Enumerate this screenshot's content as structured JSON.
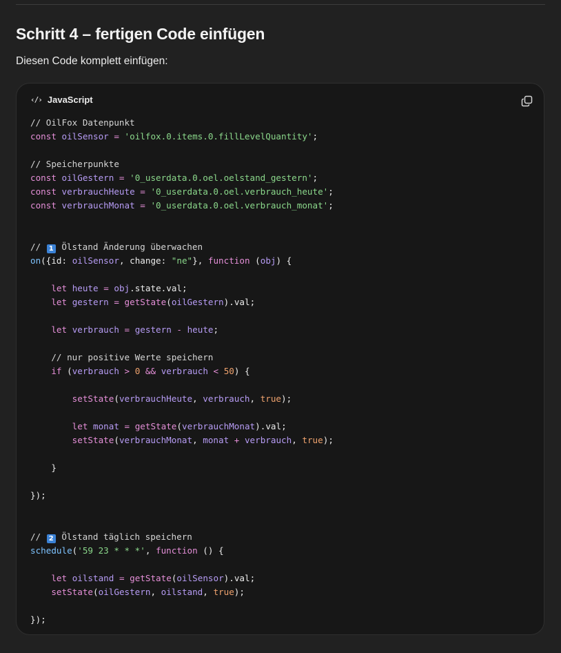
{
  "section": {
    "heading": "Schritt 4 – fertigen Code einfügen",
    "intro": "Diesen Code komplett einfügen:"
  },
  "code_block": {
    "language_label": "JavaScript",
    "language_icon": "code-brackets-icon",
    "copy_icon": "copy-icon",
    "lines": [
      [
        [
          "comment",
          "// OilFox Datenpunkt"
        ]
      ],
      [
        [
          "keyword",
          "const "
        ],
        [
          "var",
          "oilSensor"
        ],
        [
          "plain",
          " "
        ],
        [
          "op",
          "="
        ],
        [
          "plain",
          " "
        ],
        [
          "string",
          "'oilfox.0.items.0.fillLevelQuantity'"
        ],
        [
          "punct",
          ";"
        ]
      ],
      [],
      [
        [
          "comment",
          "// Speicherpunkte"
        ]
      ],
      [
        [
          "keyword",
          "const "
        ],
        [
          "var",
          "oilGestern"
        ],
        [
          "plain",
          " "
        ],
        [
          "op",
          "="
        ],
        [
          "plain",
          " "
        ],
        [
          "string",
          "'0_userdata.0.oel.oelstand_gestern'"
        ],
        [
          "punct",
          ";"
        ]
      ],
      [
        [
          "keyword",
          "const "
        ],
        [
          "var",
          "verbrauchHeute"
        ],
        [
          "plain",
          " "
        ],
        [
          "op",
          "="
        ],
        [
          "plain",
          " "
        ],
        [
          "string",
          "'0_userdata.0.oel.verbrauch_heute'"
        ],
        [
          "punct",
          ";"
        ]
      ],
      [
        [
          "keyword",
          "const "
        ],
        [
          "var",
          "verbrauchMonat"
        ],
        [
          "plain",
          " "
        ],
        [
          "op",
          "="
        ],
        [
          "plain",
          " "
        ],
        [
          "string",
          "'0_userdata.0.oel.verbrauch_monat'"
        ],
        [
          "punct",
          ";"
        ]
      ],
      [],
      [],
      [
        [
          "comment",
          "// "
        ],
        [
          "emoji",
          "1"
        ],
        [
          "comment",
          " Ölstand Änderung überwachen"
        ]
      ],
      [
        [
          "builtin",
          "on"
        ],
        [
          "punct",
          "({"
        ],
        [
          "prop",
          "id: "
        ],
        [
          "var",
          "oilSensor"
        ],
        [
          "punct",
          ", "
        ],
        [
          "prop",
          "change: "
        ],
        [
          "string",
          "\"ne\""
        ],
        [
          "punct",
          "}, "
        ],
        [
          "keyword",
          "function"
        ],
        [
          "plain",
          " "
        ],
        [
          "punct",
          "("
        ],
        [
          "var",
          "obj"
        ],
        [
          "punct",
          ") {"
        ]
      ],
      [],
      [
        [
          "plain",
          "    "
        ],
        [
          "keyword",
          "let "
        ],
        [
          "var",
          "heute"
        ],
        [
          "plain",
          " "
        ],
        [
          "op",
          "="
        ],
        [
          "plain",
          " "
        ],
        [
          "var",
          "obj"
        ],
        [
          "punct",
          "."
        ],
        [
          "prop",
          "state"
        ],
        [
          "punct",
          "."
        ],
        [
          "prop",
          "val"
        ],
        [
          "punct",
          ";"
        ]
      ],
      [
        [
          "plain",
          "    "
        ],
        [
          "keyword",
          "let "
        ],
        [
          "var",
          "gestern"
        ],
        [
          "plain",
          " "
        ],
        [
          "op",
          "="
        ],
        [
          "plain",
          " "
        ],
        [
          "fn",
          "getState"
        ],
        [
          "punct",
          "("
        ],
        [
          "var",
          "oilGestern"
        ],
        [
          "punct",
          ")."
        ],
        [
          "prop",
          "val"
        ],
        [
          "punct",
          ";"
        ]
      ],
      [],
      [
        [
          "plain",
          "    "
        ],
        [
          "keyword",
          "let "
        ],
        [
          "var",
          "verbrauch"
        ],
        [
          "plain",
          " "
        ],
        [
          "op",
          "="
        ],
        [
          "plain",
          " "
        ],
        [
          "var",
          "gestern"
        ],
        [
          "plain",
          " "
        ],
        [
          "op",
          "-"
        ],
        [
          "plain",
          " "
        ],
        [
          "var",
          "heute"
        ],
        [
          "punct",
          ";"
        ]
      ],
      [],
      [
        [
          "plain",
          "    "
        ],
        [
          "comment",
          "// nur positive Werte speichern"
        ]
      ],
      [
        [
          "plain",
          "    "
        ],
        [
          "keyword",
          "if"
        ],
        [
          "plain",
          " "
        ],
        [
          "punct",
          "("
        ],
        [
          "var",
          "verbrauch"
        ],
        [
          "plain",
          " "
        ],
        [
          "op",
          ">"
        ],
        [
          "plain",
          " "
        ],
        [
          "number",
          "0"
        ],
        [
          "plain",
          " "
        ],
        [
          "op",
          "&&"
        ],
        [
          "plain",
          " "
        ],
        [
          "var",
          "verbrauch"
        ],
        [
          "plain",
          " "
        ],
        [
          "op",
          "<"
        ],
        [
          "plain",
          " "
        ],
        [
          "number",
          "50"
        ],
        [
          "punct",
          ") {"
        ]
      ],
      [],
      [
        [
          "plain",
          "        "
        ],
        [
          "fn",
          "setState"
        ],
        [
          "punct",
          "("
        ],
        [
          "var",
          "verbrauchHeute"
        ],
        [
          "punct",
          ", "
        ],
        [
          "var",
          "verbrauch"
        ],
        [
          "punct",
          ", "
        ],
        [
          "bool",
          "true"
        ],
        [
          "punct",
          ");"
        ]
      ],
      [],
      [
        [
          "plain",
          "        "
        ],
        [
          "keyword",
          "let "
        ],
        [
          "var",
          "monat"
        ],
        [
          "plain",
          " "
        ],
        [
          "op",
          "="
        ],
        [
          "plain",
          " "
        ],
        [
          "fn",
          "getState"
        ],
        [
          "punct",
          "("
        ],
        [
          "var",
          "verbrauchMonat"
        ],
        [
          "punct",
          ")."
        ],
        [
          "prop",
          "val"
        ],
        [
          "punct",
          ";"
        ]
      ],
      [
        [
          "plain",
          "        "
        ],
        [
          "fn",
          "setState"
        ],
        [
          "punct",
          "("
        ],
        [
          "var",
          "verbrauchMonat"
        ],
        [
          "punct",
          ", "
        ],
        [
          "var",
          "monat"
        ],
        [
          "plain",
          " "
        ],
        [
          "op",
          "+"
        ],
        [
          "plain",
          " "
        ],
        [
          "var",
          "verbrauch"
        ],
        [
          "punct",
          ", "
        ],
        [
          "bool",
          "true"
        ],
        [
          "punct",
          ");"
        ]
      ],
      [],
      [
        [
          "plain",
          "    "
        ],
        [
          "punct",
          "}"
        ]
      ],
      [],
      [
        [
          "punct",
          "});"
        ]
      ],
      [],
      [],
      [
        [
          "comment",
          "// "
        ],
        [
          "emoji",
          "2"
        ],
        [
          "comment",
          " Ölstand täglich speichern"
        ]
      ],
      [
        [
          "builtin",
          "schedule"
        ],
        [
          "punct",
          "("
        ],
        [
          "string",
          "'59 23 * * *'"
        ],
        [
          "punct",
          ", "
        ],
        [
          "keyword",
          "function"
        ],
        [
          "plain",
          " "
        ],
        [
          "punct",
          "() {"
        ]
      ],
      [],
      [
        [
          "plain",
          "    "
        ],
        [
          "keyword",
          "let "
        ],
        [
          "var",
          "oilstand"
        ],
        [
          "plain",
          " "
        ],
        [
          "op",
          "="
        ],
        [
          "plain",
          " "
        ],
        [
          "fn",
          "getState"
        ],
        [
          "punct",
          "("
        ],
        [
          "var",
          "oilSensor"
        ],
        [
          "punct",
          ")."
        ],
        [
          "prop",
          "val"
        ],
        [
          "punct",
          ";"
        ]
      ],
      [
        [
          "plain",
          "    "
        ],
        [
          "fn",
          "setState"
        ],
        [
          "punct",
          "("
        ],
        [
          "var",
          "oilGestern"
        ],
        [
          "punct",
          ", "
        ],
        [
          "var",
          "oilstand"
        ],
        [
          "punct",
          ", "
        ],
        [
          "bool",
          "true"
        ],
        [
          "punct",
          ");"
        ]
      ],
      [],
      [
        [
          "punct",
          "});"
        ]
      ]
    ]
  }
}
